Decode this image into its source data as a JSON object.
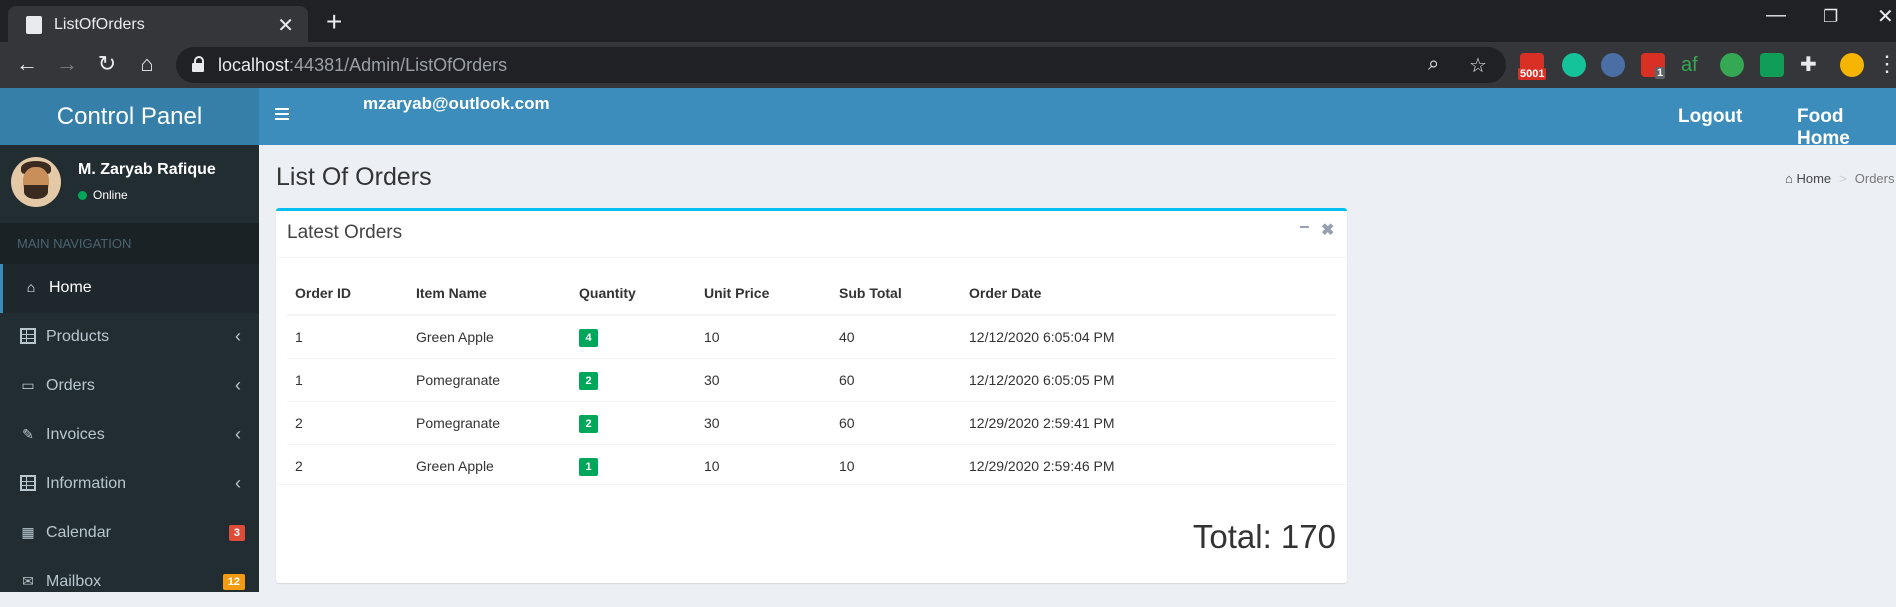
{
  "browser": {
    "tab_title": "ListOfOrders",
    "url_host": "localhost",
    "url_path": ":44381/Admin/ListOfOrders",
    "gmail_count": "5001",
    "ext_badge": "1"
  },
  "header": {
    "brand": "Control Panel",
    "user_email": "mzaryab@outlook.com",
    "logout": "Logout",
    "food_home": "Food Home"
  },
  "sidebar": {
    "user_name": "M. Zaryab Rafique",
    "user_status": "Online",
    "section_header": "MAIN NAVIGATION",
    "items": [
      {
        "label": "Home",
        "icon": "dashboard-icon"
      },
      {
        "label": "Products",
        "icon": "table-icon"
      },
      {
        "label": "Orders",
        "icon": "laptop-icon"
      },
      {
        "label": "Invoices",
        "icon": "edit-icon"
      },
      {
        "label": "Information",
        "icon": "table-icon"
      },
      {
        "label": "Calendar",
        "icon": "calendar-icon",
        "badge": "3"
      },
      {
        "label": "Mailbox",
        "icon": "envelope-icon",
        "badge": "12"
      }
    ],
    "badge_colors": {
      "calendar": "#dd4b39",
      "mailbox": "#f39c12"
    }
  },
  "page": {
    "title": "List Of Orders",
    "breadcrumb_home": "Home",
    "breadcrumb_current": "Orders"
  },
  "orders_box": {
    "title": "Latest Orders",
    "columns": [
      "Order ID",
      "Item Name",
      "Quantity",
      "Unit Price",
      "Sub Total",
      "Order Date"
    ],
    "rows": [
      {
        "order_id": "1",
        "item": "Green Apple",
        "quantity": "4",
        "unit_price": "10",
        "sub_total": "40",
        "date": "12/12/2020 6:05:04 PM"
      },
      {
        "order_id": "1",
        "item": "Pomegranate",
        "quantity": "2",
        "unit_price": "30",
        "sub_total": "60",
        "date": "12/12/2020 6:05:05 PM"
      },
      {
        "order_id": "2",
        "item": "Pomegranate",
        "quantity": "2",
        "unit_price": "30",
        "sub_total": "60",
        "date": "12/29/2020 2:59:41 PM"
      },
      {
        "order_id": "2",
        "item": "Green Apple",
        "quantity": "1",
        "unit_price": "10",
        "sub_total": "10",
        "date": "12/29/2020 2:59:46 PM"
      }
    ],
    "total": "Total: 170"
  },
  "colors": {
    "accent": "#3c8dbc",
    "logo_bg": "#367fa9",
    "sidebar_bg": "#222d32",
    "box_border": "#00c0ef",
    "badge_green": "#00a65a"
  }
}
